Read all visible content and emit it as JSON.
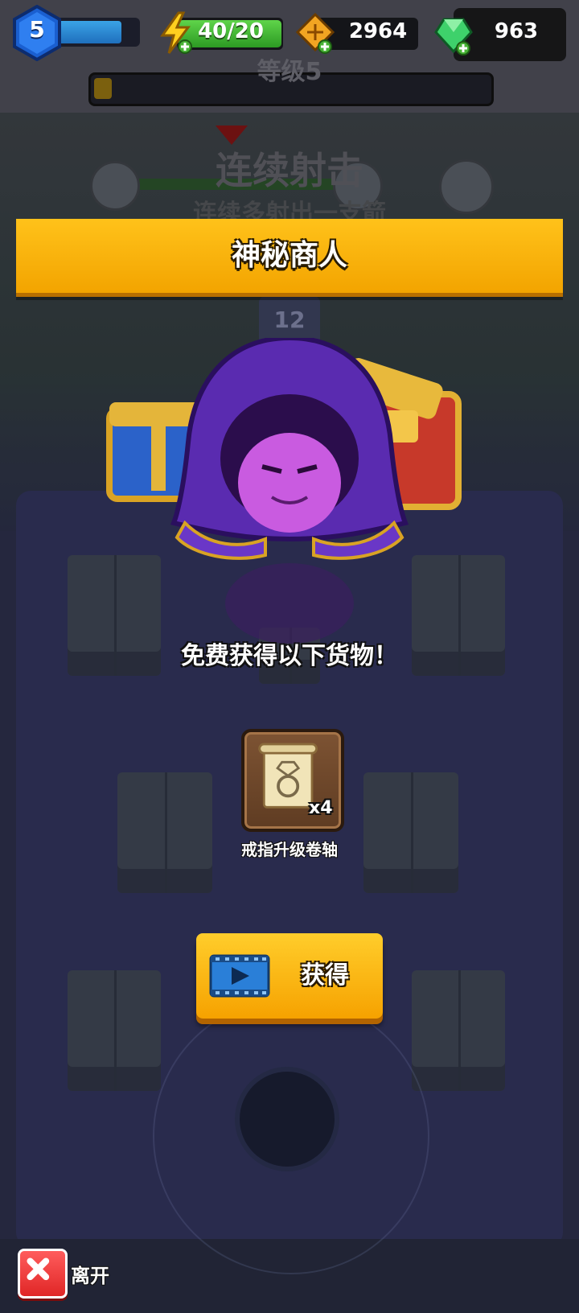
{
  "hud": {
    "player_level": "5",
    "xp_progress": 0.78,
    "energy": "40/20",
    "energy_fill": 1.0,
    "coins": "2964",
    "gems": "963"
  },
  "background": {
    "level_label": "等级5",
    "skill_title": "连续射击",
    "skill_desc": "连续多射出一支箭",
    "stage_number": "12"
  },
  "dialog": {
    "title": "神秘商人",
    "offer_text": "免费获得以下货物！",
    "item": {
      "icon": "ring-upgrade-scroll-icon",
      "quantity": "x4",
      "name": "戒指升级卷轴"
    },
    "get_button_label": "获得",
    "leave_label": "离开"
  },
  "colors": {
    "banner": "#f8b200",
    "button": "#fbb710",
    "energy": "#46b832",
    "xp": "#2b8ad6",
    "close": "#e63434"
  }
}
